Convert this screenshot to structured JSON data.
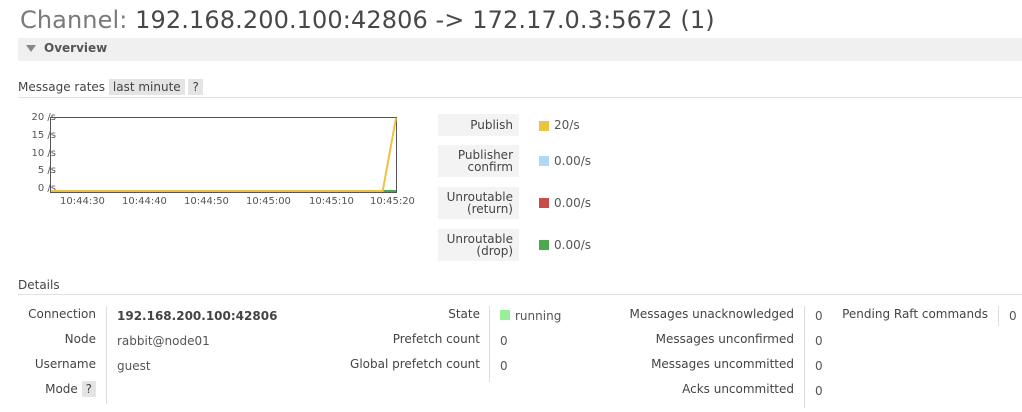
{
  "header": {
    "title_prefix": "Channel: ",
    "title_value": "192.168.200.100:42806 -> 172.17.0.3:5672 (1)"
  },
  "overview": {
    "section_label": "Overview"
  },
  "message_rates": {
    "label": "Message rates",
    "range": "last minute",
    "help": "?"
  },
  "chart_data": {
    "type": "line",
    "x": [
      "10:44:30",
      "10:44:40",
      "10:44:50",
      "10:45:00",
      "10:45:10",
      "10:45:20"
    ],
    "y_ticks": [
      "20 /s",
      "15 /s",
      "10 /s",
      "5 /s",
      "0 /s"
    ],
    "ylim": [
      0,
      20
    ],
    "series": [
      {
        "name": "Publish",
        "color": "#edc240",
        "points": [
          [
            0,
            0
          ],
          [
            50,
            0
          ],
          [
            52,
            20
          ]
        ]
      },
      {
        "name": "Publisher confirm",
        "color": "#afd8f8",
        "points": [
          [
            0,
            0
          ],
          [
            52,
            0
          ]
        ]
      },
      {
        "name": "Unroutable (return)",
        "color": "#cb4b4b",
        "points": [
          [
            0,
            0
          ],
          [
            52,
            0
          ]
        ]
      },
      {
        "name": "Unroutable (drop)",
        "color": "#4da74d",
        "points": [
          [
            0,
            0
          ],
          [
            52,
            0
          ]
        ]
      }
    ]
  },
  "legend": [
    {
      "line1": "Publish",
      "line2": "",
      "value": "20/s",
      "color": "#edc240"
    },
    {
      "line1": "Publisher",
      "line2": "confirm",
      "value": "0.00/s",
      "color": "#afd8f8"
    },
    {
      "line1": "Unroutable",
      "line2": "(return)",
      "value": "0.00/s",
      "color": "#cb4b4b"
    },
    {
      "line1": "Unroutable",
      "line2": "(drop)",
      "value": "0.00/s",
      "color": "#4da74d"
    }
  ],
  "details": {
    "heading": "Details",
    "connection_label": "Connection",
    "connection_value": "192.168.200.100:42806",
    "node_label": "Node",
    "node_value": "rabbit@node01",
    "username_label": "Username",
    "username_value": "guest",
    "mode_label": "Mode",
    "mode_help": "?",
    "state_label": "State",
    "state_value": "running",
    "state_color": "#99ee99",
    "prefetch_label": "Prefetch count",
    "prefetch_value": "0",
    "global_prefetch_label": "Global prefetch count",
    "global_prefetch_value": "0",
    "unacked_label": "Messages unacknowledged",
    "unacked_value": "0",
    "unconfirmed_label": "Messages unconfirmed",
    "unconfirmed_value": "0",
    "uncommitted_label": "Messages uncommitted",
    "uncommitted_value": "0",
    "acks_uncommitted_label": "Acks uncommitted",
    "acks_uncommitted_value": "0",
    "raft_label": "Pending Raft commands",
    "raft_value": "0"
  }
}
